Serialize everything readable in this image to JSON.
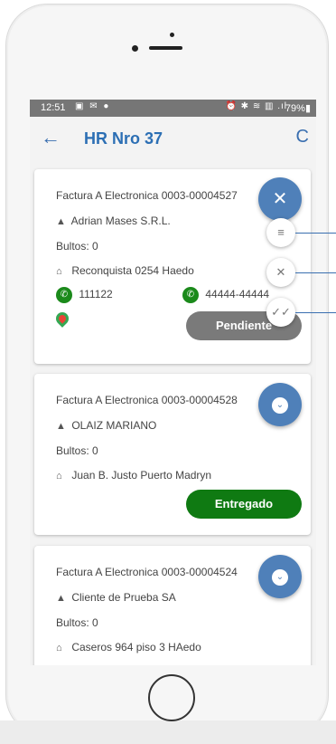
{
  "status_bar": {
    "time": "12:51",
    "left_icons": "▣ ✉ ●",
    "right_icons": "⏰ ✱ ≋ ▥ .ıl",
    "battery": "79%▮"
  },
  "app_bar": {
    "back_icon": "←",
    "title": "HR Nro 37",
    "refresh_icon": "C"
  },
  "cards": [
    {
      "invoice": "Factura A Electronica 0003-00004527",
      "client": "Adrian Mases S.R.L.",
      "bultos": "Bultos: 0",
      "address": "Reconquista 0254 Haedo",
      "phone1": "111122",
      "phone2": "44444-44444",
      "status": "Pendiente"
    },
    {
      "invoice": "Factura A Electronica 0003-00004528",
      "client": "OLAIZ MARIANO",
      "bultos": "Bultos: 0",
      "address": "Juan B. Justo Puerto Madryn",
      "status": "Entregado"
    },
    {
      "invoice": "Factura A Electronica 0003-00004524",
      "client": "Cliente de Prueba SA",
      "bultos": "Bultos: 0",
      "address": "Caseros 964 piso 3 HAedo"
    }
  ],
  "fab_menu": {
    "close_icon": "✕",
    "list_icon": "≡",
    "cancel_icon": "✕",
    "done_all_icon": "✓✓",
    "expand_icon": "⌄"
  },
  "icons": {
    "person": "▲",
    "home": "⌂",
    "phone": "✆"
  },
  "colors": {
    "accent": "#2c6fb4",
    "fab": "#4f80b9",
    "pending": "#7a7a7a",
    "delivered": "#0f7a12",
    "phone_green": "#1b8a1b"
  }
}
